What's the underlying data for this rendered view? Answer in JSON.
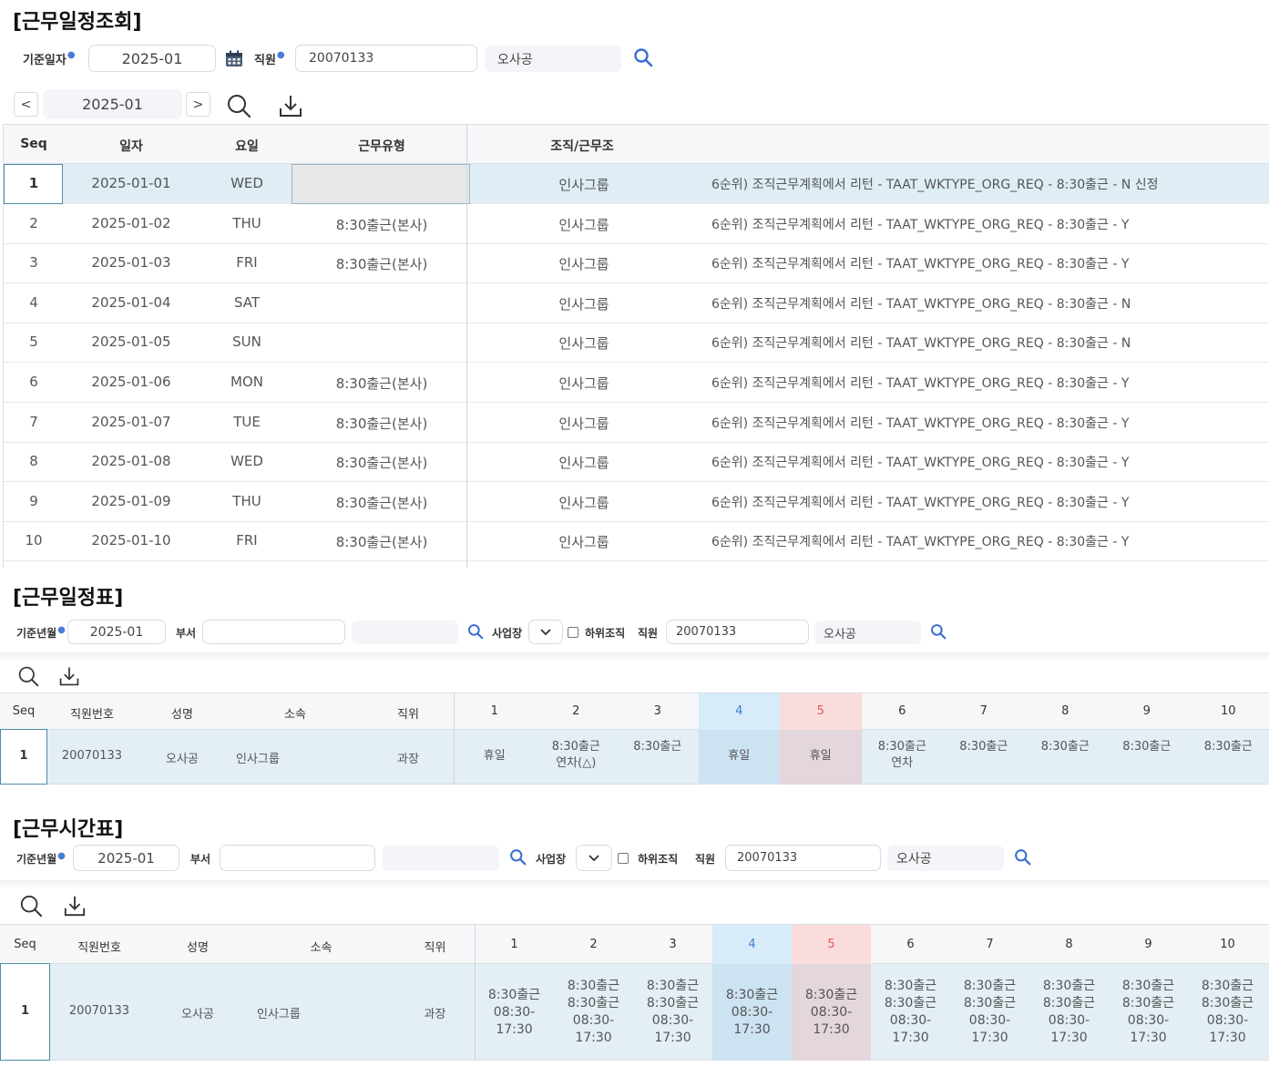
{
  "section1": {
    "title": "[근무일정조회]",
    "filter": {
      "date_label": "기준일자",
      "date_value": "2025-01",
      "employee_label": "직원",
      "employee_id": "20070133",
      "employee_name": "오사공"
    },
    "toolbar": {
      "prev": "<",
      "month": "2025-01",
      "next": ">"
    },
    "grid": {
      "headers": {
        "seq": "Seq",
        "date": "일자",
        "day": "요일",
        "type": "근무유형",
        "org": "조직/근무조"
      },
      "rows": [
        {
          "seq": "1",
          "date": "2025-01-01",
          "day": "WED",
          "type": "",
          "org": "인사그룹",
          "desc": "6순위) 조직근무계획에서 리턴 - TAAT_WKTYPE_ORG_REQ - 8:30출근 - N 신정"
        },
        {
          "seq": "2",
          "date": "2025-01-02",
          "day": "THU",
          "type": "8:30출근(본사)",
          "org": "인사그룹",
          "desc": "6순위) 조직근무계획에서 리턴 - TAAT_WKTYPE_ORG_REQ - 8:30출근 - Y"
        },
        {
          "seq": "3",
          "date": "2025-01-03",
          "day": "FRI",
          "type": "8:30출근(본사)",
          "org": "인사그룹",
          "desc": "6순위) 조직근무계획에서 리턴 - TAAT_WKTYPE_ORG_REQ - 8:30출근 - Y"
        },
        {
          "seq": "4",
          "date": "2025-01-04",
          "day": "SAT",
          "type": "",
          "org": "인사그룹",
          "desc": "6순위) 조직근무계획에서 리턴 - TAAT_WKTYPE_ORG_REQ - 8:30출근 - N"
        },
        {
          "seq": "5",
          "date": "2025-01-05",
          "day": "SUN",
          "type": "",
          "org": "인사그룹",
          "desc": "6순위) 조직근무계획에서 리턴 - TAAT_WKTYPE_ORG_REQ - 8:30출근 - N"
        },
        {
          "seq": "6",
          "date": "2025-01-06",
          "day": "MON",
          "type": "8:30출근(본사)",
          "org": "인사그룹",
          "desc": "6순위) 조직근무계획에서 리턴 - TAAT_WKTYPE_ORG_REQ - 8:30출근 - Y"
        },
        {
          "seq": "7",
          "date": "2025-01-07",
          "day": "TUE",
          "type": "8:30출근(본사)",
          "org": "인사그룹",
          "desc": "6순위) 조직근무계획에서 리턴 - TAAT_WKTYPE_ORG_REQ - 8:30출근 - Y"
        },
        {
          "seq": "8",
          "date": "2025-01-08",
          "day": "WED",
          "type": "8:30출근(본사)",
          "org": "인사그룹",
          "desc": "6순위) 조직근무계획에서 리턴 - TAAT_WKTYPE_ORG_REQ - 8:30출근 - Y"
        },
        {
          "seq": "9",
          "date": "2025-01-09",
          "day": "THU",
          "type": "8:30출근(본사)",
          "org": "인사그룹",
          "desc": "6순위) 조직근무계획에서 리턴 - TAAT_WKTYPE_ORG_REQ - 8:30출근 - Y"
        },
        {
          "seq": "10",
          "date": "2025-01-10",
          "day": "FRI",
          "type": "8:30출근(본사)",
          "org": "인사그룹",
          "desc": "6순위) 조직근무계획에서 리턴 - TAAT_WKTYPE_ORG_REQ - 8:30출근 - Y"
        }
      ]
    }
  },
  "section2": {
    "title": "[근무일정표]",
    "filter": {
      "month_label": "기준년월",
      "month_value": "2025-01",
      "dept_label": "부서",
      "dept_value": "",
      "site_label": "사업장",
      "sub_org_label": "하위조직",
      "employee_label": "직원",
      "employee_id": "20070133",
      "employee_name": "오사공"
    },
    "grid": {
      "headers": {
        "seq": "Seq",
        "emp_no": "직원번호",
        "name": "성명",
        "org": "소속",
        "position": "직위"
      },
      "days": [
        "1",
        "2",
        "3",
        "4",
        "5",
        "6",
        "7",
        "8",
        "9",
        "10"
      ],
      "row": {
        "seq": "1",
        "emp_no": "20070133",
        "name": "오사공",
        "org": "인사그룹",
        "position": "과장",
        "cells": [
          [
            "휴일"
          ],
          [
            "8:30출근",
            "연차(△)"
          ],
          [
            "8:30출근"
          ],
          [
            "휴일"
          ],
          [
            "휴일"
          ],
          [
            "8:30출근",
            "연차"
          ],
          [
            "8:30출근"
          ],
          [
            "8:30출근"
          ],
          [
            "8:30출근"
          ],
          [
            "8:30출근"
          ]
        ]
      }
    }
  },
  "section3": {
    "title": "[근무시간표]",
    "filter": {
      "month_label": "기준년월",
      "month_value": "2025-01",
      "dept_label": "부서",
      "dept_value": "",
      "site_label": "사업장",
      "sub_org_label": "하위조직",
      "employee_label": "직원",
      "employee_id": "20070133",
      "employee_name": "오사공"
    },
    "grid": {
      "headers": {
        "seq": "Seq",
        "emp_no": "직원번호",
        "name": "성명",
        "org": "소속",
        "position": "직위"
      },
      "days": [
        "1",
        "2",
        "3",
        "4",
        "5",
        "6",
        "7",
        "8",
        "9",
        "10"
      ],
      "row": {
        "seq": "1",
        "emp_no": "20070133",
        "name": "오사공",
        "org": "인사그룹",
        "position": "과장",
        "cells": [
          [
            "8:30출근",
            "08:30-",
            "17:30"
          ],
          [
            "8:30출근",
            "8:30출근",
            "08:30-",
            "17:30"
          ],
          [
            "8:30출근",
            "8:30출근",
            "08:30-",
            "17:30"
          ],
          [
            "8:30출근",
            "08:30-",
            "17:30"
          ],
          [
            "8:30출근",
            "08:30-",
            "17:30"
          ],
          [
            "8:30출근",
            "8:30출근",
            "08:30-",
            "17:30"
          ],
          [
            "8:30출근",
            "8:30출근",
            "08:30-",
            "17:30"
          ],
          [
            "8:30출근",
            "8:30출근",
            "08:30-",
            "17:30"
          ],
          [
            "8:30출근",
            "8:30출근",
            "08:30-",
            "17:30"
          ],
          [
            "8:30출근",
            "8:30출근",
            "08:30-",
            "17:30"
          ]
        ]
      }
    }
  },
  "colors": {
    "accent": "#4a7bd6",
    "selected_row": "#dfeef5",
    "saturday_header": "#d7ebf8",
    "sunday_header": "#fbdcdc",
    "saturday_text": "#3f7fd0",
    "sunday_text": "#e05a5a"
  }
}
